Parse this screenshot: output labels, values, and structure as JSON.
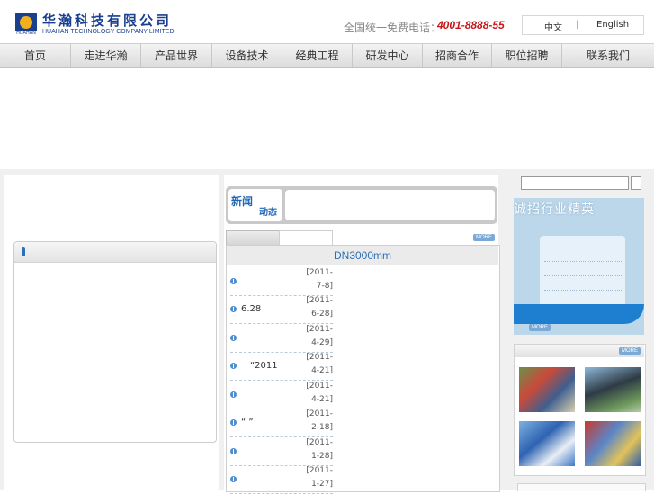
{
  "header": {
    "brand_cn": "华瀚科技有限公司",
    "brand_en": "HUAHAN TECHNOLOGY COMPANY LIMITED",
    "logo_tag": "HUAHAN",
    "hotline_label": "全国统一免费电话：",
    "hotline_number": "4001-8888-55",
    "lang_cn": "中文",
    "lang_sep": "|",
    "lang_en": "English"
  },
  "nav": [
    "首页",
    "走进华瀚",
    "产品世界",
    "设备技术",
    "经典工程",
    "研发中心",
    "招商合作",
    "职位招聘",
    "联系我们"
  ],
  "news": {
    "logo_a": "新闻",
    "logo_b": "动态",
    "more": "MORE",
    "list_title": "DN3000mm",
    "items": [
      {
        "title": "",
        "date1": "[2011-",
        "date2": "7-8]"
      },
      {
        "title": "6.28",
        "date1": "[2011-",
        "date2": "6-28]"
      },
      {
        "title": "",
        "date1": "[2011-",
        "date2": "4-29]"
      },
      {
        "title": "“2011",
        "date1": "[2011-",
        "date2": "4-21]"
      },
      {
        "title": "",
        "date1": "[2011-",
        "date2": "4-21]"
      },
      {
        "title": "“    ”",
        "date1": "[2011-",
        "date2": "2-18]"
      },
      {
        "title": "",
        "date1": "[2011-",
        "date2": "1-28]"
      },
      {
        "title": "",
        "date1": "[2011-",
        "date2": "1-27]"
      }
    ]
  },
  "recruit": {
    "title": "诚招行业精英",
    "more": "MORE"
  },
  "photos": {
    "more": "MORE"
  },
  "colors": {
    "brand_blue": "#1a3f8f",
    "hotline_red": "#c8161d",
    "link_blue": "#2d6fb6"
  }
}
